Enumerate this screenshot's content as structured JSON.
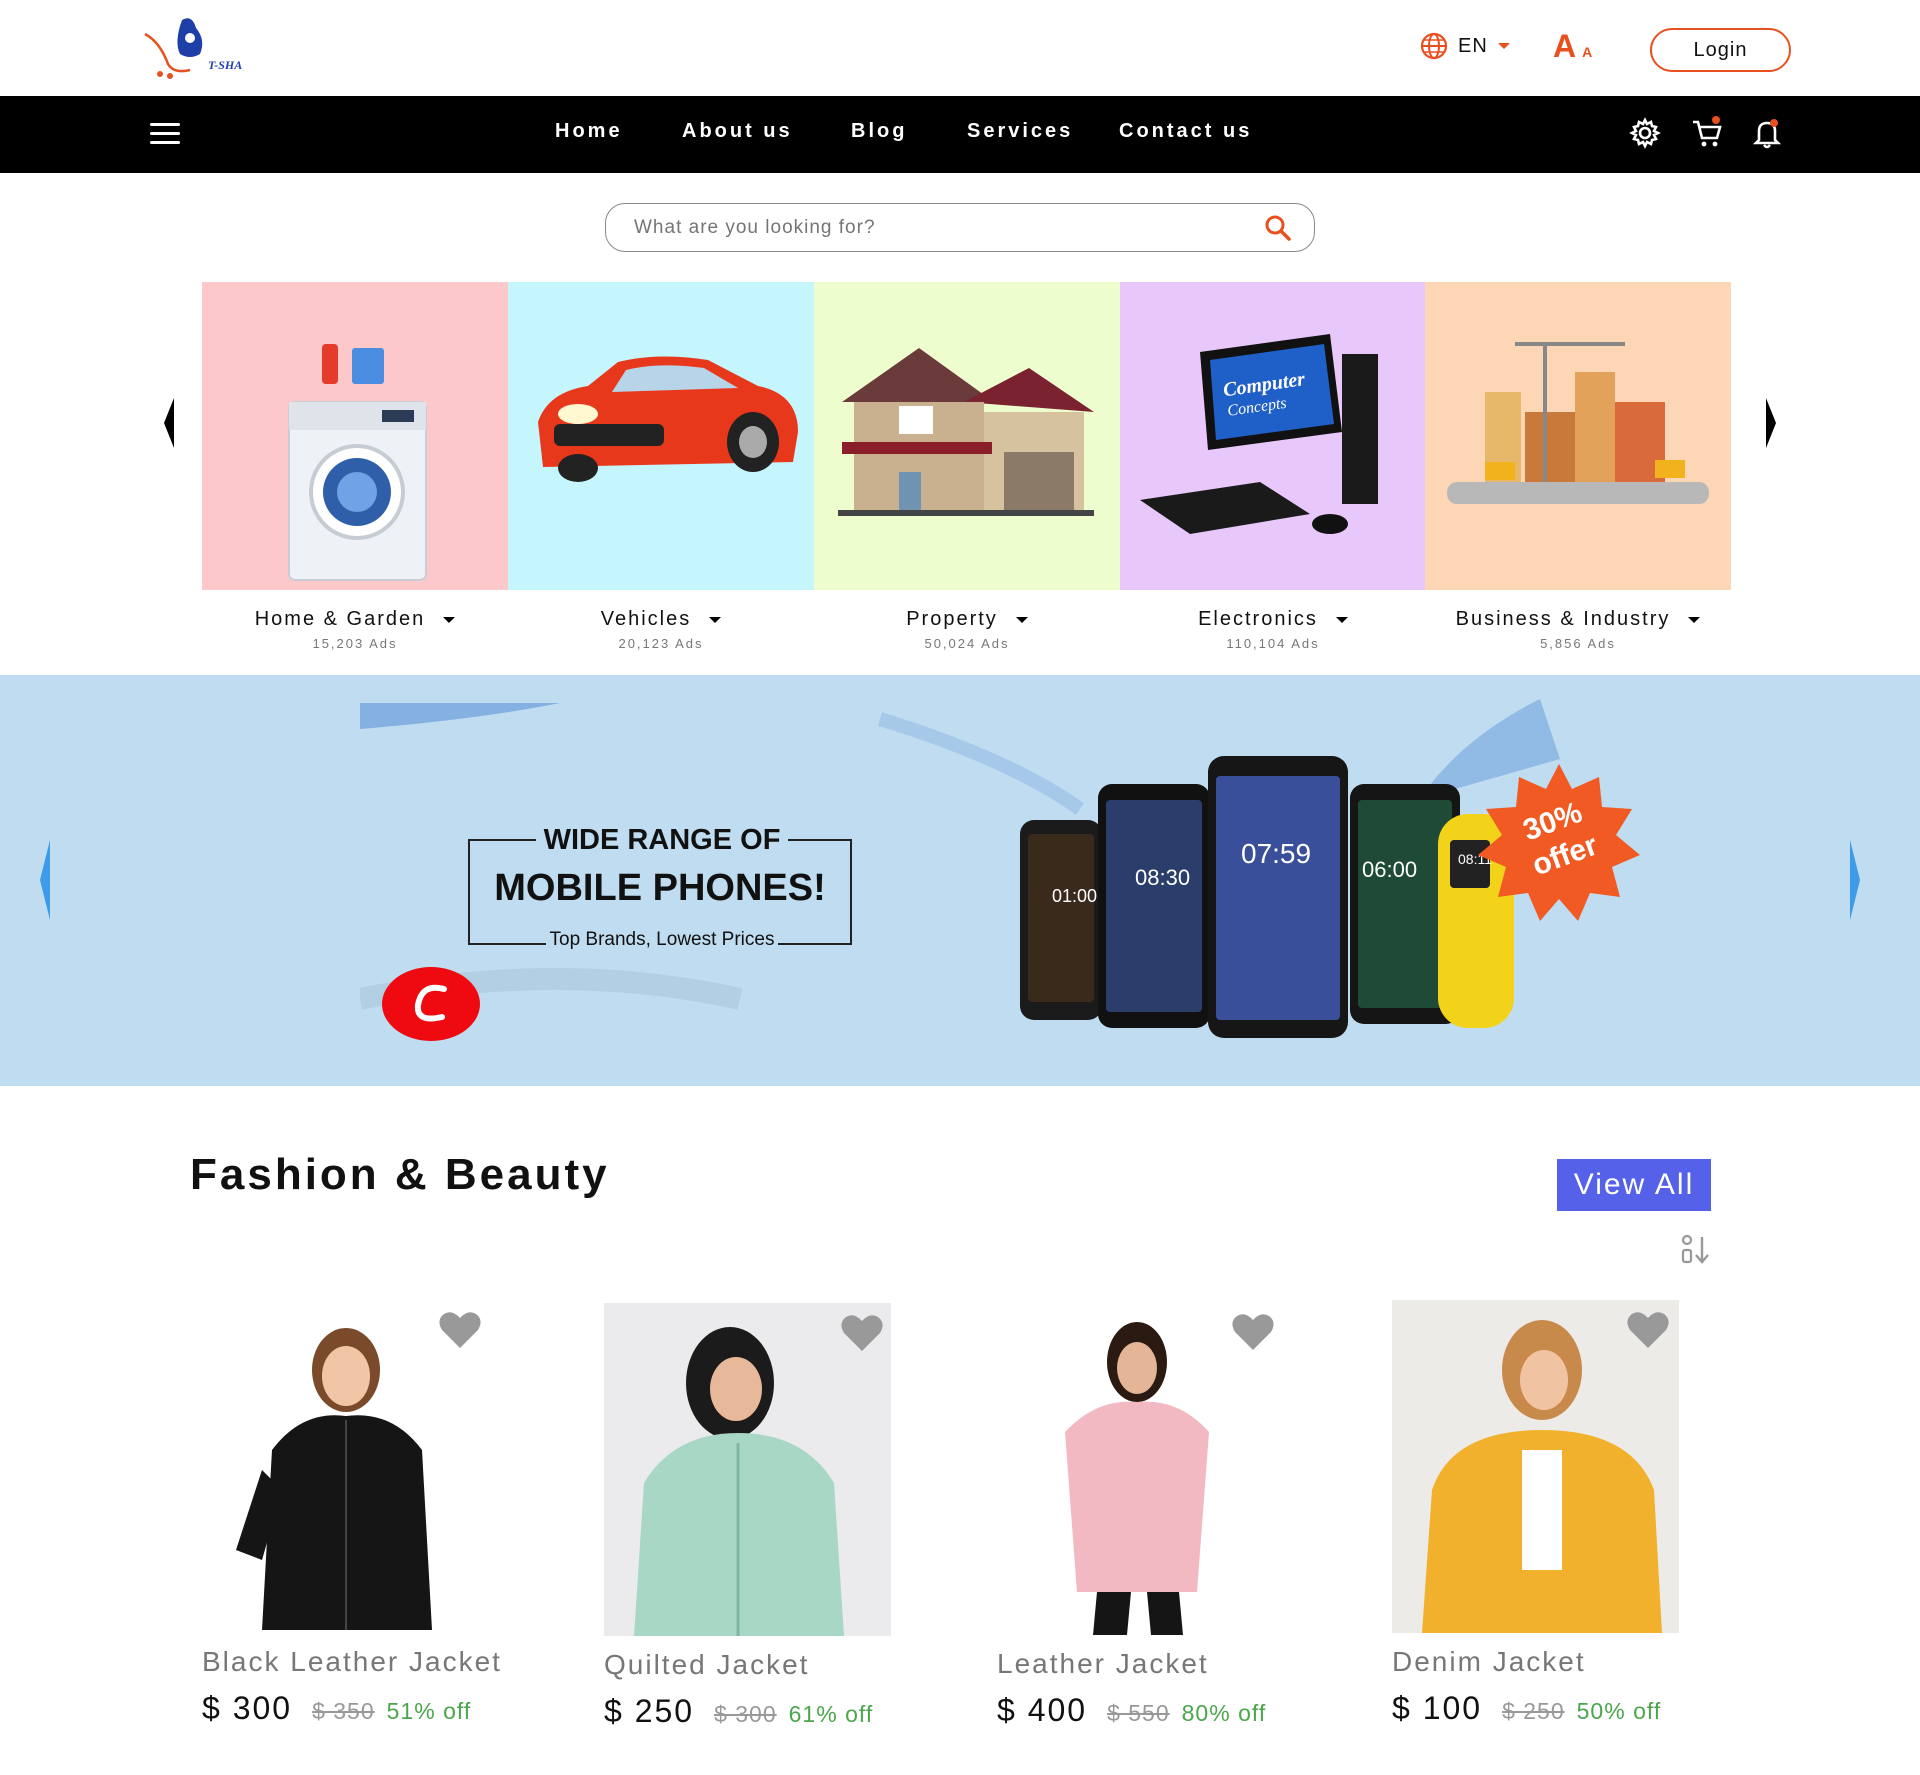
{
  "brand": {
    "logo_text": "T-SHA"
  },
  "header": {
    "language": "EN",
    "font_size_large": "A",
    "font_size_small": "A",
    "login_label": "Login"
  },
  "nav": {
    "links": [
      "Home",
      "About us",
      "Blog",
      "Services",
      "Contact us"
    ]
  },
  "search": {
    "placeholder": "What are you looking for?"
  },
  "categories": [
    {
      "name": "Home & Garden",
      "ads": "15,203 Ads",
      "bg": "#fdc8c9"
    },
    {
      "name": "Vehicles",
      "ads": "20,123 Ads",
      "bg": "#c5f5fd"
    },
    {
      "name": "Property",
      "ads": "50,024 Ads",
      "bg": "#eefdce"
    },
    {
      "name": "Electronics",
      "ads": "110,104 Ads",
      "bg": "#e8c8fb"
    },
    {
      "name": "Business & Industry",
      "ads": "5,856 Ads",
      "bg": "#fdd6b6"
    }
  ],
  "banner": {
    "line1": "WIDE RANGE OF",
    "line2": "MOBILE PHONES!",
    "line3": "Top Brands, Lowest Prices",
    "offer_line1": "30%",
    "offer_line2": "offer",
    "phone_times": [
      "01:00",
      "08:30",
      "07:59",
      "06:00",
      "08:11"
    ],
    "bg": "#bfdcf0",
    "offer_color": "#f15a22"
  },
  "section": {
    "title": "Fashion & Beauty",
    "view_all_label": "View All"
  },
  "products": [
    {
      "name": "Black Leather Jacket",
      "price": "$ 300",
      "old_price": "$ 350",
      "discount": "51% off"
    },
    {
      "name": "Quilted Jacket",
      "price": "$ 250",
      "old_price": "$ 300",
      "discount": "61% off"
    },
    {
      "name": "Leather Jacket",
      "price": "$ 400",
      "old_price": "$ 550",
      "discount": "80% off"
    },
    {
      "name": "Denim Jacket",
      "price": "$ 100",
      "old_price": "$ 250",
      "discount": "50% off"
    }
  ],
  "colors": {
    "accent": "#e8501f",
    "nav_bg": "#000000",
    "view_all_bg": "#5561e8",
    "discount": "#4ca64c"
  }
}
